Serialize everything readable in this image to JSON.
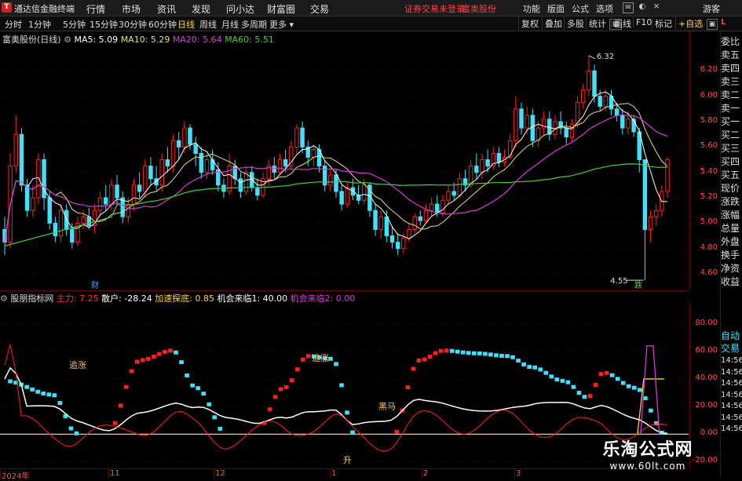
{
  "app": {
    "title": "通达信金融终端",
    "logo_char": "T"
  },
  "menu": [
    "行情",
    "市场",
    "资讯",
    "发现",
    "问小达",
    "财富圈",
    "交易"
  ],
  "promo": {
    "login_text": "证券交易未登录",
    "stock_name": "富奥股份"
  },
  "top_right": [
    "功能",
    "版面",
    "公式",
    "选项",
    "游客"
  ],
  "periods": [
    "分时",
    "1分钟",
    "5分钟",
    "15分钟",
    "30分钟",
    "60分钟",
    "日线",
    "周线",
    "月线",
    "多周期",
    "更多"
  ],
  "active_period": "日线",
  "tools": [
    "复权",
    "叠加",
    "多股",
    "统计",
    "画线",
    "F10",
    "标记"
  ],
  "zixuan": "+自选",
  "price_header": {
    "name": "富奥股份(日线)",
    "ma5": "MA5: 5.09",
    "ma10": "MA10: 5.29",
    "ma20": "MA20: 5.64",
    "ma60": "MA60: 5.51"
  },
  "price_y_ticks": [
    "6.20",
    "6.00",
    "5.80",
    "5.60",
    "5.40",
    "5.20",
    "5.00",
    "4.80",
    "4.60"
  ],
  "price_y_values": [
    6.2,
    6.0,
    5.8,
    5.6,
    5.4,
    5.2,
    5.0,
    4.8,
    4.6
  ],
  "price_range": [
    4.52,
    6.4
  ],
  "high_label": "6.32",
  "low_label": "4.55",
  "markers": {
    "cai": "财",
    "die": "跌"
  },
  "ind_header": {
    "name": "股朋指标网",
    "zhuli": "主力: 7.25",
    "sanhu": "散户: -28.24",
    "jiasu": "加速探底: 0.85",
    "jihui1": "机会来临1: 40.00",
    "jihui2": "机会来临2: 0.00"
  },
  "ind_y_ticks": [
    "80.00",
    "60.00",
    "40.00",
    "20.00",
    "0.00",
    "-20.00"
  ],
  "ind_y_values": [
    80,
    60,
    40,
    20,
    0,
    -20
  ],
  "ind_range": [
    -22,
    90
  ],
  "ind_annotations": {
    "zhuizhang1": "追涨",
    "zhuizhang2": "追涨",
    "heima": "黑马",
    "sheng": "升"
  },
  "x_labels": [
    "2024年",
    "11",
    "12",
    "1",
    "2",
    "3"
  ],
  "x_positions": [
    0,
    138,
    272,
    420,
    537,
    655
  ],
  "right_panel": [
    "委比",
    "卖五",
    "卖四",
    "卖三",
    "卖二",
    "卖一",
    "买一",
    "买二",
    "买三",
    "买四",
    "买五",
    "现价",
    "涨跌",
    "涨幅",
    "总量",
    "外盘",
    "换手",
    "净资",
    "收益",
    "自动",
    "交易"
  ],
  "right_times": [
    "14:56",
    "14:56",
    "14:56",
    "14:56",
    "14:56",
    "14:56",
    "14:56"
  ],
  "watermark": {
    "title": "乐淘公式网",
    "url": "www.60lt.com"
  },
  "colors": {
    "up": "#ff2020",
    "down": "#40e0ff",
    "ma5": "#ffffff",
    "ma10": "#e8e070",
    "ma20": "#d040d0",
    "ma60": "#40d040"
  },
  "chart_data": {
    "type": "candlestick",
    "title": "富奥股份(日线)",
    "ylim": [
      4.52,
      6.4
    ],
    "candles": [
      [
        4.95,
        4.85,
        5.05,
        4.75
      ],
      [
        4.85,
        5.45,
        5.55,
        4.8
      ],
      [
        5.45,
        5.7,
        5.85,
        5.4
      ],
      [
        5.7,
        5.3,
        5.75,
        5.25
      ],
      [
        5.3,
        5.1,
        5.35,
        5.05
      ],
      [
        5.1,
        5.2,
        5.3,
        5.05
      ],
      [
        5.2,
        5.5,
        5.55,
        5.15
      ],
      [
        5.5,
        5.2,
        5.55,
        5.1
      ],
      [
        5.2,
        5.0,
        5.25,
        4.95
      ],
      [
        5.0,
        4.9,
        5.05,
        4.85
      ],
      [
        4.9,
        5.1,
        5.15,
        4.85
      ],
      [
        5.1,
        4.95,
        5.15,
        4.9
      ],
      [
        4.95,
        4.85,
        5.0,
        4.8
      ],
      [
        4.85,
        5.0,
        5.05,
        4.82
      ],
      [
        5.0,
        5.05,
        5.1,
        4.95
      ],
      [
        5.05,
        4.98,
        5.12,
        4.95
      ],
      [
        4.98,
        5.1,
        5.15,
        4.92
      ],
      [
        5.1,
        5.2,
        5.25,
        5.05
      ],
      [
        5.2,
        5.15,
        5.3,
        5.1
      ],
      [
        5.15,
        5.3,
        5.35,
        5.1
      ],
      [
        5.3,
        5.2,
        5.38,
        5.15
      ],
      [
        5.2,
        5.05,
        5.25,
        5.0
      ],
      [
        5.05,
        5.15,
        5.2,
        5.0
      ],
      [
        5.15,
        5.3,
        5.35,
        5.1
      ],
      [
        5.3,
        5.25,
        5.4,
        5.2
      ],
      [
        5.25,
        5.45,
        5.5,
        5.2
      ],
      [
        5.45,
        5.35,
        5.52,
        5.3
      ],
      [
        5.35,
        5.3,
        5.45,
        5.25
      ],
      [
        5.3,
        5.5,
        5.55,
        5.25
      ],
      [
        5.5,
        5.45,
        5.6,
        5.4
      ],
      [
        5.45,
        5.65,
        5.7,
        5.4
      ],
      [
        5.65,
        5.6,
        5.72,
        5.5
      ],
      [
        5.6,
        5.75,
        5.8,
        5.55
      ],
      [
        5.75,
        5.62,
        5.78,
        5.58
      ],
      [
        5.62,
        5.55,
        5.68,
        5.45
      ],
      [
        5.55,
        5.4,
        5.6,
        5.35
      ],
      [
        5.4,
        5.5,
        5.55,
        5.35
      ],
      [
        5.5,
        5.42,
        5.58,
        5.38
      ],
      [
        5.42,
        5.3,
        5.48,
        5.25
      ],
      [
        5.3,
        5.25,
        5.35,
        5.2
      ],
      [
        5.25,
        5.45,
        5.55,
        5.22
      ],
      [
        5.45,
        5.35,
        5.5,
        5.3
      ],
      [
        5.35,
        5.25,
        5.4,
        5.2
      ],
      [
        5.25,
        5.4,
        5.45,
        5.22
      ],
      [
        5.4,
        5.28,
        5.45,
        5.25
      ],
      [
        5.28,
        5.22,
        5.35,
        5.18
      ],
      [
        5.22,
        5.35,
        5.4,
        5.2
      ],
      [
        5.35,
        5.45,
        5.5,
        5.3
      ],
      [
        5.45,
        5.4,
        5.52,
        5.35
      ],
      [
        5.4,
        5.5,
        5.55,
        5.38
      ],
      [
        5.5,
        5.45,
        5.58,
        5.4
      ],
      [
        5.45,
        5.6,
        5.65,
        5.42
      ],
      [
        5.6,
        5.75,
        5.78,
        5.55
      ],
      [
        5.75,
        5.6,
        5.8,
        5.55
      ],
      [
        5.6,
        5.52,
        5.65,
        5.45
      ],
      [
        5.52,
        5.58,
        5.62,
        5.45
      ],
      [
        5.58,
        5.45,
        5.62,
        5.4
      ],
      [
        5.45,
        5.3,
        5.5,
        5.25
      ],
      [
        5.3,
        5.38,
        5.42,
        5.25
      ],
      [
        5.38,
        5.25,
        5.42,
        5.2
      ],
      [
        5.25,
        5.15,
        5.3,
        5.1
      ],
      [
        5.15,
        5.28,
        5.32,
        5.12
      ],
      [
        5.28,
        5.22,
        5.35,
        5.18
      ],
      [
        5.22,
        5.18,
        5.3,
        5.15
      ],
      [
        5.18,
        5.3,
        5.35,
        5.15
      ],
      [
        5.3,
        5.1,
        5.32,
        5.05
      ],
      [
        5.1,
        4.95,
        5.15,
        4.9
      ],
      [
        4.95,
        5.05,
        5.1,
        4.88
      ],
      [
        5.05,
        4.9,
        5.1,
        4.85
      ],
      [
        4.9,
        4.85,
        4.98,
        4.8
      ],
      [
        4.85,
        4.8,
        4.92,
        4.75
      ],
      [
        4.8,
        4.88,
        4.92,
        4.76
      ],
      [
        4.88,
        4.95,
        5.0,
        4.85
      ],
      [
        4.95,
        5.05,
        5.08,
        4.92
      ],
      [
        5.05,
        5.02,
        5.1,
        4.98
      ],
      [
        5.02,
        5.1,
        5.15,
        5.0
      ],
      [
        5.1,
        5.15,
        5.2,
        5.05
      ],
      [
        5.15,
        5.08,
        5.22,
        5.05
      ],
      [
        5.08,
        5.18,
        5.22,
        5.05
      ],
      [
        5.18,
        5.25,
        5.3,
        5.15
      ],
      [
        5.25,
        5.22,
        5.32,
        5.18
      ],
      [
        5.22,
        5.35,
        5.4,
        5.2
      ],
      [
        5.35,
        5.3,
        5.42,
        5.25
      ],
      [
        5.3,
        5.45,
        5.5,
        5.28
      ],
      [
        5.45,
        5.4,
        5.55,
        5.35
      ],
      [
        5.4,
        5.5,
        5.55,
        5.35
      ],
      [
        5.5,
        5.45,
        5.58,
        5.4
      ],
      [
        5.45,
        5.55,
        5.6,
        5.42
      ],
      [
        5.55,
        5.48,
        5.6,
        5.44
      ],
      [
        5.48,
        5.52,
        5.58,
        5.45
      ],
      [
        5.52,
        5.65,
        5.7,
        5.5
      ],
      [
        5.65,
        5.9,
        6.0,
        5.6
      ],
      [
        5.9,
        5.75,
        5.95,
        5.7
      ],
      [
        5.75,
        5.85,
        5.92,
        5.7
      ],
      [
        5.85,
        5.65,
        5.9,
        5.6
      ],
      [
        5.65,
        5.75,
        5.8,
        5.6
      ],
      [
        5.75,
        5.82,
        5.88,
        5.7
      ],
      [
        5.82,
        5.7,
        5.88,
        5.65
      ],
      [
        5.7,
        5.8,
        5.85,
        5.66
      ],
      [
        5.8,
        5.75,
        5.88,
        5.7
      ],
      [
        5.75,
        5.68,
        5.8,
        5.62
      ],
      [
        5.68,
        5.78,
        5.82,
        5.64
      ],
      [
        5.78,
        5.95,
        6.0,
        5.75
      ],
      [
        5.95,
        6.05,
        6.1,
        5.9
      ],
      [
        6.05,
        6.2,
        6.32,
        6.0
      ],
      [
        6.2,
        6.0,
        6.25,
        5.95
      ],
      [
        6.0,
        5.92,
        6.05,
        5.88
      ],
      [
        5.92,
        6.0,
        6.05,
        5.88
      ],
      [
        6.0,
        5.9,
        6.05,
        5.85
      ],
      [
        5.9,
        5.85,
        5.95,
        5.8
      ],
      [
        5.85,
        5.75,
        5.9,
        5.7
      ],
      [
        5.75,
        5.82,
        5.88,
        5.7
      ],
      [
        5.82,
        5.72,
        5.85,
        5.68
      ],
      [
        5.72,
        5.5,
        5.75,
        5.4
      ],
      [
        5.5,
        4.95,
        5.5,
        4.55
      ],
      [
        4.95,
        5.05,
        5.1,
        4.85
      ],
      [
        5.05,
        5.1,
        5.15,
        4.98
      ],
      [
        5.1,
        5.25,
        5.3,
        5.05
      ],
      [
        5.25,
        5.5,
        5.52,
        5.2
      ]
    ],
    "series": [
      {
        "name": "MA5",
        "value": 5.09
      },
      {
        "name": "MA10",
        "value": 5.29
      },
      {
        "name": "MA20",
        "value": 5.64
      },
      {
        "name": "MA60",
        "value": 5.51
      }
    ]
  }
}
